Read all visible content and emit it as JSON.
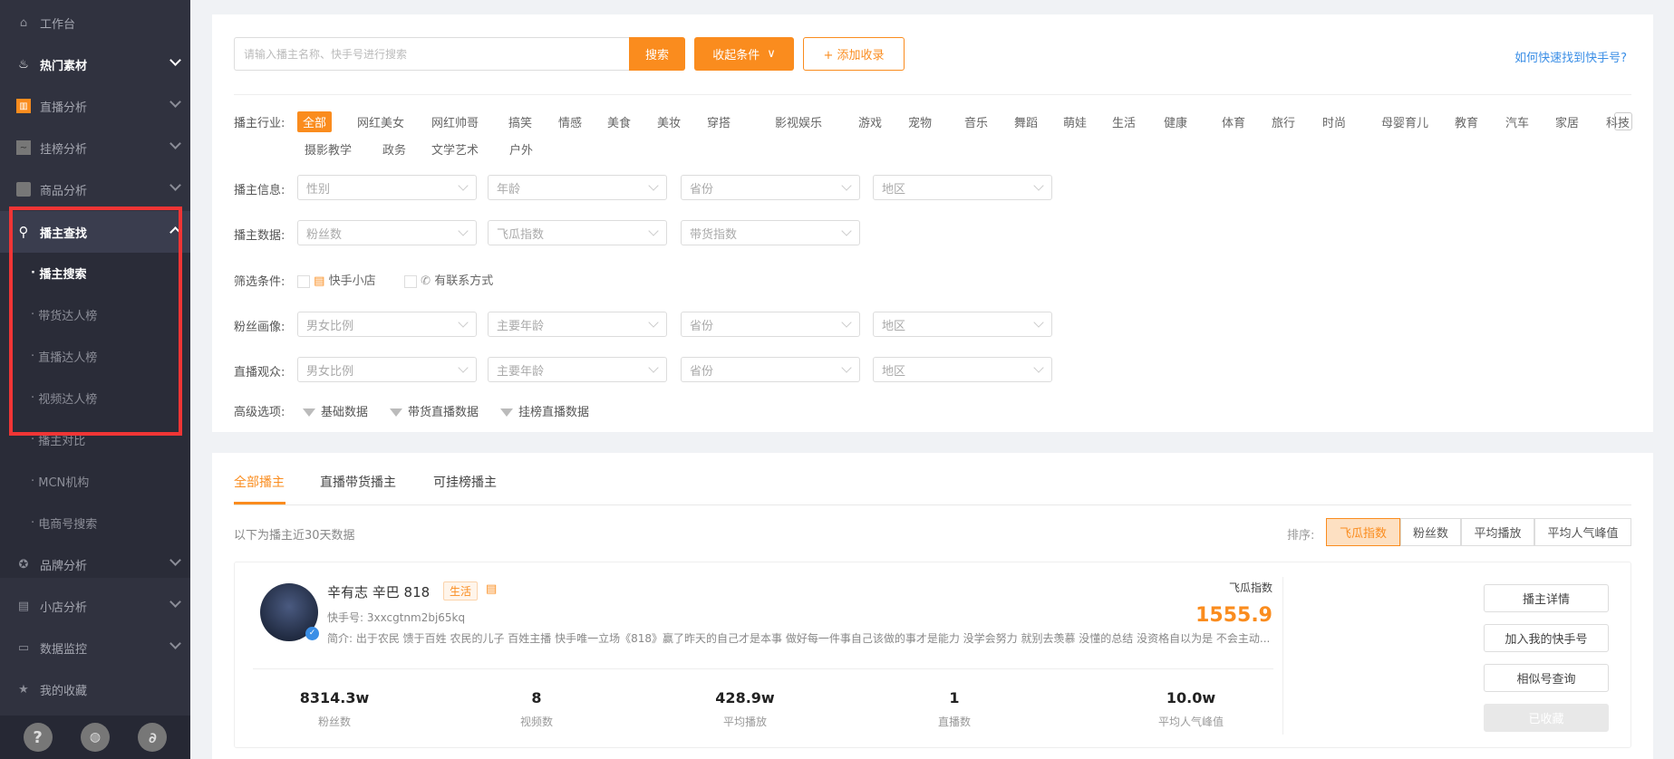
{
  "sidebar": {
    "items": [
      {
        "label": "工作台",
        "icon": "home-icon"
      },
      {
        "label": "热门素材",
        "icon": "fire-icon"
      },
      {
        "label": "直播分析",
        "icon": "bar-chart-icon"
      },
      {
        "label": "挂榜分析",
        "icon": "line-chart-icon"
      },
      {
        "label": "商品分析",
        "icon": "bag-icon"
      },
      {
        "label": "播主查找",
        "icon": "search-icon"
      }
    ],
    "sub_items": [
      "播主搜索",
      "带货达人榜",
      "直播达人榜",
      "视频达人榜",
      "播主对比",
      "MCN机构",
      "电商号搜索"
    ],
    "items2": [
      {
        "label": "品牌分析",
        "icon": "medal-icon"
      },
      {
        "label": "小店分析",
        "icon": "shop-icon"
      },
      {
        "label": "数据监控",
        "icon": "monitor-icon"
      },
      {
        "label": "我的收藏",
        "icon": "star-icon"
      }
    ],
    "bottom": {
      "help": "?"
    }
  },
  "search": {
    "placeholder": "请输入播主名称、快手号进行搜索",
    "button": "搜索",
    "collapse": "收起条件",
    "add": "+ 添加收录",
    "help_link": "如何快速找到快手号?"
  },
  "filters": {
    "industry_label": "播主行业:",
    "industries": [
      "全部",
      "网红美女",
      "网红帅哥",
      "搞笑",
      "情感",
      "美食",
      "美妆",
      "穿搭",
      "影视娱乐",
      "游戏",
      "宠物",
      "音乐",
      "舞蹈",
      "萌娃",
      "生活",
      "健康",
      "体育",
      "旅行",
      "时尚",
      "母婴育儿",
      "教育",
      "汽车",
      "家居",
      "科技"
    ],
    "industries_row2": [
      "摄影教学",
      "政务",
      "文学艺术",
      "户外"
    ],
    "info_label": "播主信息:",
    "info": [
      "性别",
      "年龄",
      "省份",
      "地区"
    ],
    "data_label": "播主数据:",
    "data": [
      "粉丝数",
      "飞瓜指数",
      "带货指数"
    ],
    "cond_label": "筛选条件:",
    "conds": [
      "快手小店",
      "有联系方式"
    ],
    "fan_label": "粉丝画像:",
    "fan": [
      "男女比例",
      "主要年龄",
      "省份",
      "地区"
    ],
    "aud_label": "直播观众:",
    "aud": [
      "男女比例",
      "主要年龄",
      "省份",
      "地区"
    ],
    "adv_label": "高级选项:",
    "adv": [
      "基础数据",
      "带货直播数据",
      "挂榜直播数据"
    ]
  },
  "results": {
    "tabs": [
      "全部播主",
      "直播带货播主",
      "可挂榜播主"
    ],
    "note": "以下为播主近30天数据",
    "sort_label": "排序:",
    "sort": [
      "飞瓜指数",
      "粉丝数",
      "平均播放",
      "平均人气峰值"
    ],
    "accent": "#fa8c1e",
    "item": {
      "name": "辛有志 辛巴 818",
      "tag": "生活",
      "id": "快手号: 3xxcgtnm2bj65kq",
      "intro": "简介: 出于农民 馈于百姓 农民的儿子 百姓主播 快手唯一立场《818》赢了昨天的自己才是本事 做好每一件事自己该做的事才是能力 没学会努力 就别去羡慕 没懂的总结 没资格自以为是 不会主动...",
      "index_label": "飞瓜指数",
      "index": "1555.9",
      "stats": [
        {
          "v": "8314.3w",
          "l": "粉丝数"
        },
        {
          "v": "8",
          "l": "视频数"
        },
        {
          "v": "428.9w",
          "l": "平均播放"
        },
        {
          "v": "1",
          "l": "直播数"
        },
        {
          "v": "10.0w",
          "l": "平均人气峰值"
        }
      ],
      "buttons": [
        "播主详情",
        "加入我的快手号",
        "相似号查询",
        "已收藏"
      ]
    }
  }
}
